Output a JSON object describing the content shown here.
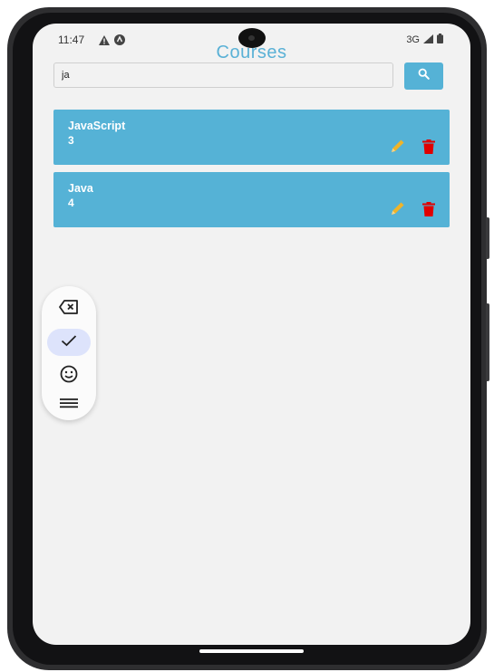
{
  "status_bar": {
    "time": "11:47",
    "network": "3G"
  },
  "app": {
    "title": "Courses"
  },
  "search": {
    "value": "ja",
    "button_icon": "search-icon"
  },
  "courses": [
    {
      "name": "JavaScript",
      "value": "3",
      "edit_icon": "pencil-icon",
      "delete_icon": "trash-icon"
    },
    {
      "name": "Java",
      "value": "4",
      "edit_icon": "pencil-icon",
      "delete_icon": "trash-icon"
    }
  ],
  "floating_toolbar": {
    "items": [
      "backspace-icon",
      "check-icon",
      "emoji-icon",
      "menu-icon"
    ],
    "active_item": "check-icon"
  },
  "colors": {
    "accent": "#55b2d6",
    "edit": "#f0b429",
    "delete": "#e00000",
    "background": "#f2f2f2"
  }
}
